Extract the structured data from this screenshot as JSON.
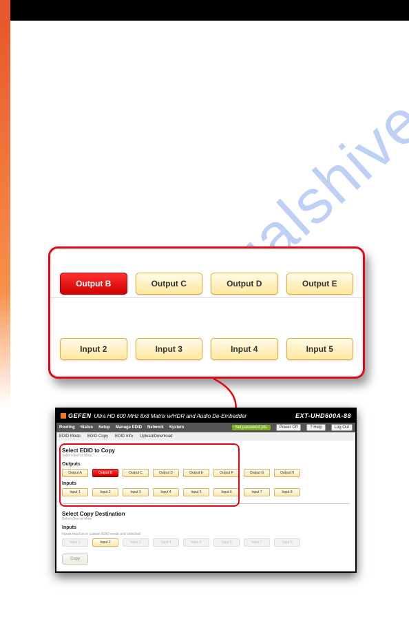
{
  "watermark_text": "manualshive.com",
  "zoom": {
    "outputs": [
      {
        "label": "Output B",
        "selected": true
      },
      {
        "label": "Output C",
        "selected": false
      },
      {
        "label": "Output D",
        "selected": false
      },
      {
        "label": "Output E",
        "selected": false
      }
    ],
    "inputs": [
      {
        "label": "Input 2"
      },
      {
        "label": "Input 3"
      },
      {
        "label": "Input 4"
      },
      {
        "label": "Input 5"
      }
    ]
  },
  "panel": {
    "brand": "GEFEN",
    "title": "Ultra HD 600 MHz 8x8 Matrix w/HDR and Audio De-Embedder",
    "model": "EXT-UHD600A-88",
    "tabs": [
      "Routing",
      "Status",
      "Setup",
      "Manage EDID",
      "Network",
      "System"
    ],
    "right_pill": "Set password pls.",
    "right_buttons": [
      "Power Off",
      "? Help",
      "Log Out"
    ],
    "subtabs": [
      "EDID Mode",
      "EDID Copy",
      "EDID Info",
      "Upload/Download"
    ],
    "select_section": {
      "title": "Select EDID to Copy",
      "subtitle": "Select One or More",
      "outputs_label": "Outputs",
      "outputs": [
        {
          "label": "Output A",
          "sel": false
        },
        {
          "label": "Output B",
          "sel": true
        },
        {
          "label": "Output C",
          "sel": false
        },
        {
          "label": "Output D",
          "sel": false
        },
        {
          "label": "Output E",
          "sel": false
        },
        {
          "label": "Output F",
          "sel": false
        },
        {
          "label": "Output G",
          "sel": false
        },
        {
          "label": "Output H",
          "sel": false
        }
      ],
      "inputs_label": "Inputs",
      "inputs": [
        {
          "label": "Input 1"
        },
        {
          "label": "Input 2"
        },
        {
          "label": "Input 3"
        },
        {
          "label": "Input 4"
        },
        {
          "label": "Input 5"
        },
        {
          "label": "Input 6"
        },
        {
          "label": "Input 7"
        },
        {
          "label": "Input 8"
        }
      ]
    },
    "dest_section": {
      "title": "Select Copy Destination",
      "subtitle": "Select One or More",
      "inputs_label": "Inputs",
      "inputs_sub": "Inputs must be in custom EDID mode and unlocked",
      "inputs": [
        {
          "label": "Input 1",
          "dis": true
        },
        {
          "label": "Input 2",
          "dis": false
        },
        {
          "label": "Input 3",
          "dis": true
        },
        {
          "label": "Input 4",
          "dis": true
        },
        {
          "label": "Input 5",
          "dis": true
        },
        {
          "label": "Input 6",
          "dis": true
        },
        {
          "label": "Input 7",
          "dis": true
        },
        {
          "label": "Input 8",
          "dis": true
        }
      ]
    },
    "copy_label": "Copy"
  }
}
